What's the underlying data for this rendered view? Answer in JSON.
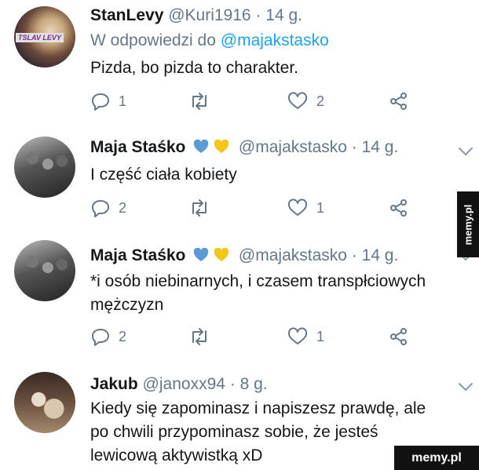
{
  "tweets": [
    {
      "name": "StanLevy",
      "handle": "@Kuri1916 · 14 g.",
      "reply_prefix": "W odpowiedzi do",
      "reply_handle": "@majakstasko",
      "avatar_label": "TSLAV LEVY",
      "lines": [
        "Pizda, bo pizda to charakter."
      ],
      "replies": "1",
      "likes": "2"
    },
    {
      "name": "Maja Staśko",
      "handle": "@majakstasko · 14 g.",
      "heart_colors": [
        "#5b9bd5",
        "#f5c518"
      ],
      "lines": [
        "I część ciała kobiety"
      ],
      "replies": "2",
      "likes": "1"
    },
    {
      "name": "Maja Staśko",
      "handle": "@majakstasko · 14 g.",
      "heart_colors": [
        "#5b9bd5",
        "#f5c518"
      ],
      "lines": [
        "*i osób niebinarnych, i czasem transpłciowych",
        "mężczyzn"
      ],
      "replies": "2",
      "likes": "1"
    },
    {
      "name": "Jakub",
      "handle": "@janoxx94 · 8 g.",
      "lines": [
        "Kiedy się zapominasz i napiszesz prawdę, ale",
        "po chwili przypominasz sobie, że jesteś",
        "lewicową aktywistką xD"
      ]
    }
  ],
  "watermark_side": "memy.pl",
  "watermark_corner": "memy.pl",
  "icons": [
    "reply-icon",
    "retweet-icon",
    "like-icon",
    "share-icon",
    "chevron-down-icon"
  ]
}
